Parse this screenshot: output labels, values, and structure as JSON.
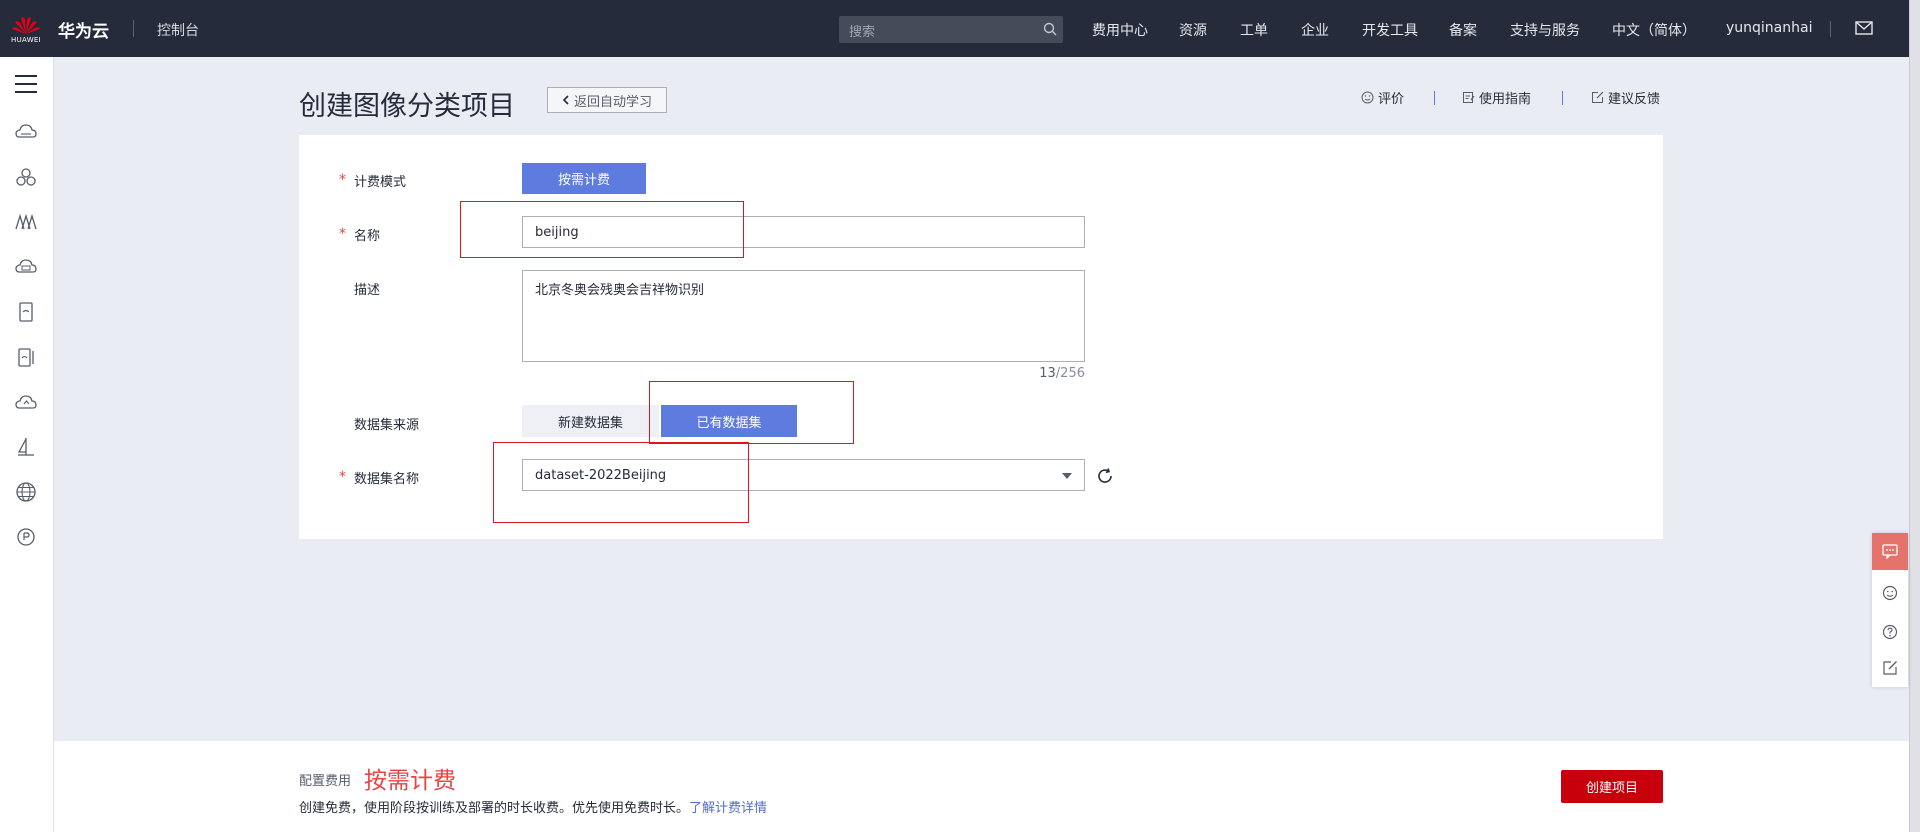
{
  "header": {
    "logo_text": "HUAWEI",
    "brand": "华为云",
    "console": "控制台",
    "search_placeholder": "搜索",
    "nav": [
      "费用中心",
      "资源",
      "工单",
      "企业",
      "开发工具",
      "备案",
      "支持与服务",
      "中文（简体）",
      "yunqinanhai"
    ]
  },
  "sidebar": {
    "icons": [
      "cloud-icon",
      "cluster-icon",
      "modelarts-icon",
      "cloud-storage-icon",
      "device-icon",
      "devices-icon",
      "cloud-upload-icon",
      "ship-icon",
      "globe-icon",
      "badge-icon"
    ]
  },
  "page": {
    "title": "创建图像分类项目",
    "back_label": "返回自动学习",
    "rate_label": "评价",
    "guide_label": "使用指南",
    "feedback_label": "建议反馈"
  },
  "form": {
    "billing_label": "计费模式",
    "billing_value": "按需计费",
    "name_label": "名称",
    "name_value": "beijing",
    "desc_label": "描述",
    "desc_value": "北京冬奥会残奥会吉祥物识别",
    "desc_count": "13",
    "desc_max": "/256",
    "source_label": "数据集来源",
    "source_new": "新建数据集",
    "source_existing": "已有数据集",
    "dataset_label": "数据集名称",
    "dataset_value": "dataset-2022Beijing",
    "required_mark": "*"
  },
  "footer": {
    "fee_label": "配置费用",
    "fee_value": "按需计费",
    "note": "创建免费，使用阶段按训练及部署的时长收费。优先使用免费时长。",
    "note_link": "了解计费详情",
    "create_label": "创建项目"
  },
  "colors": {
    "topbar": "#252b3a",
    "primary": "#5e7ce0",
    "danger": "#c7000b",
    "annotation": "#e0141e"
  }
}
